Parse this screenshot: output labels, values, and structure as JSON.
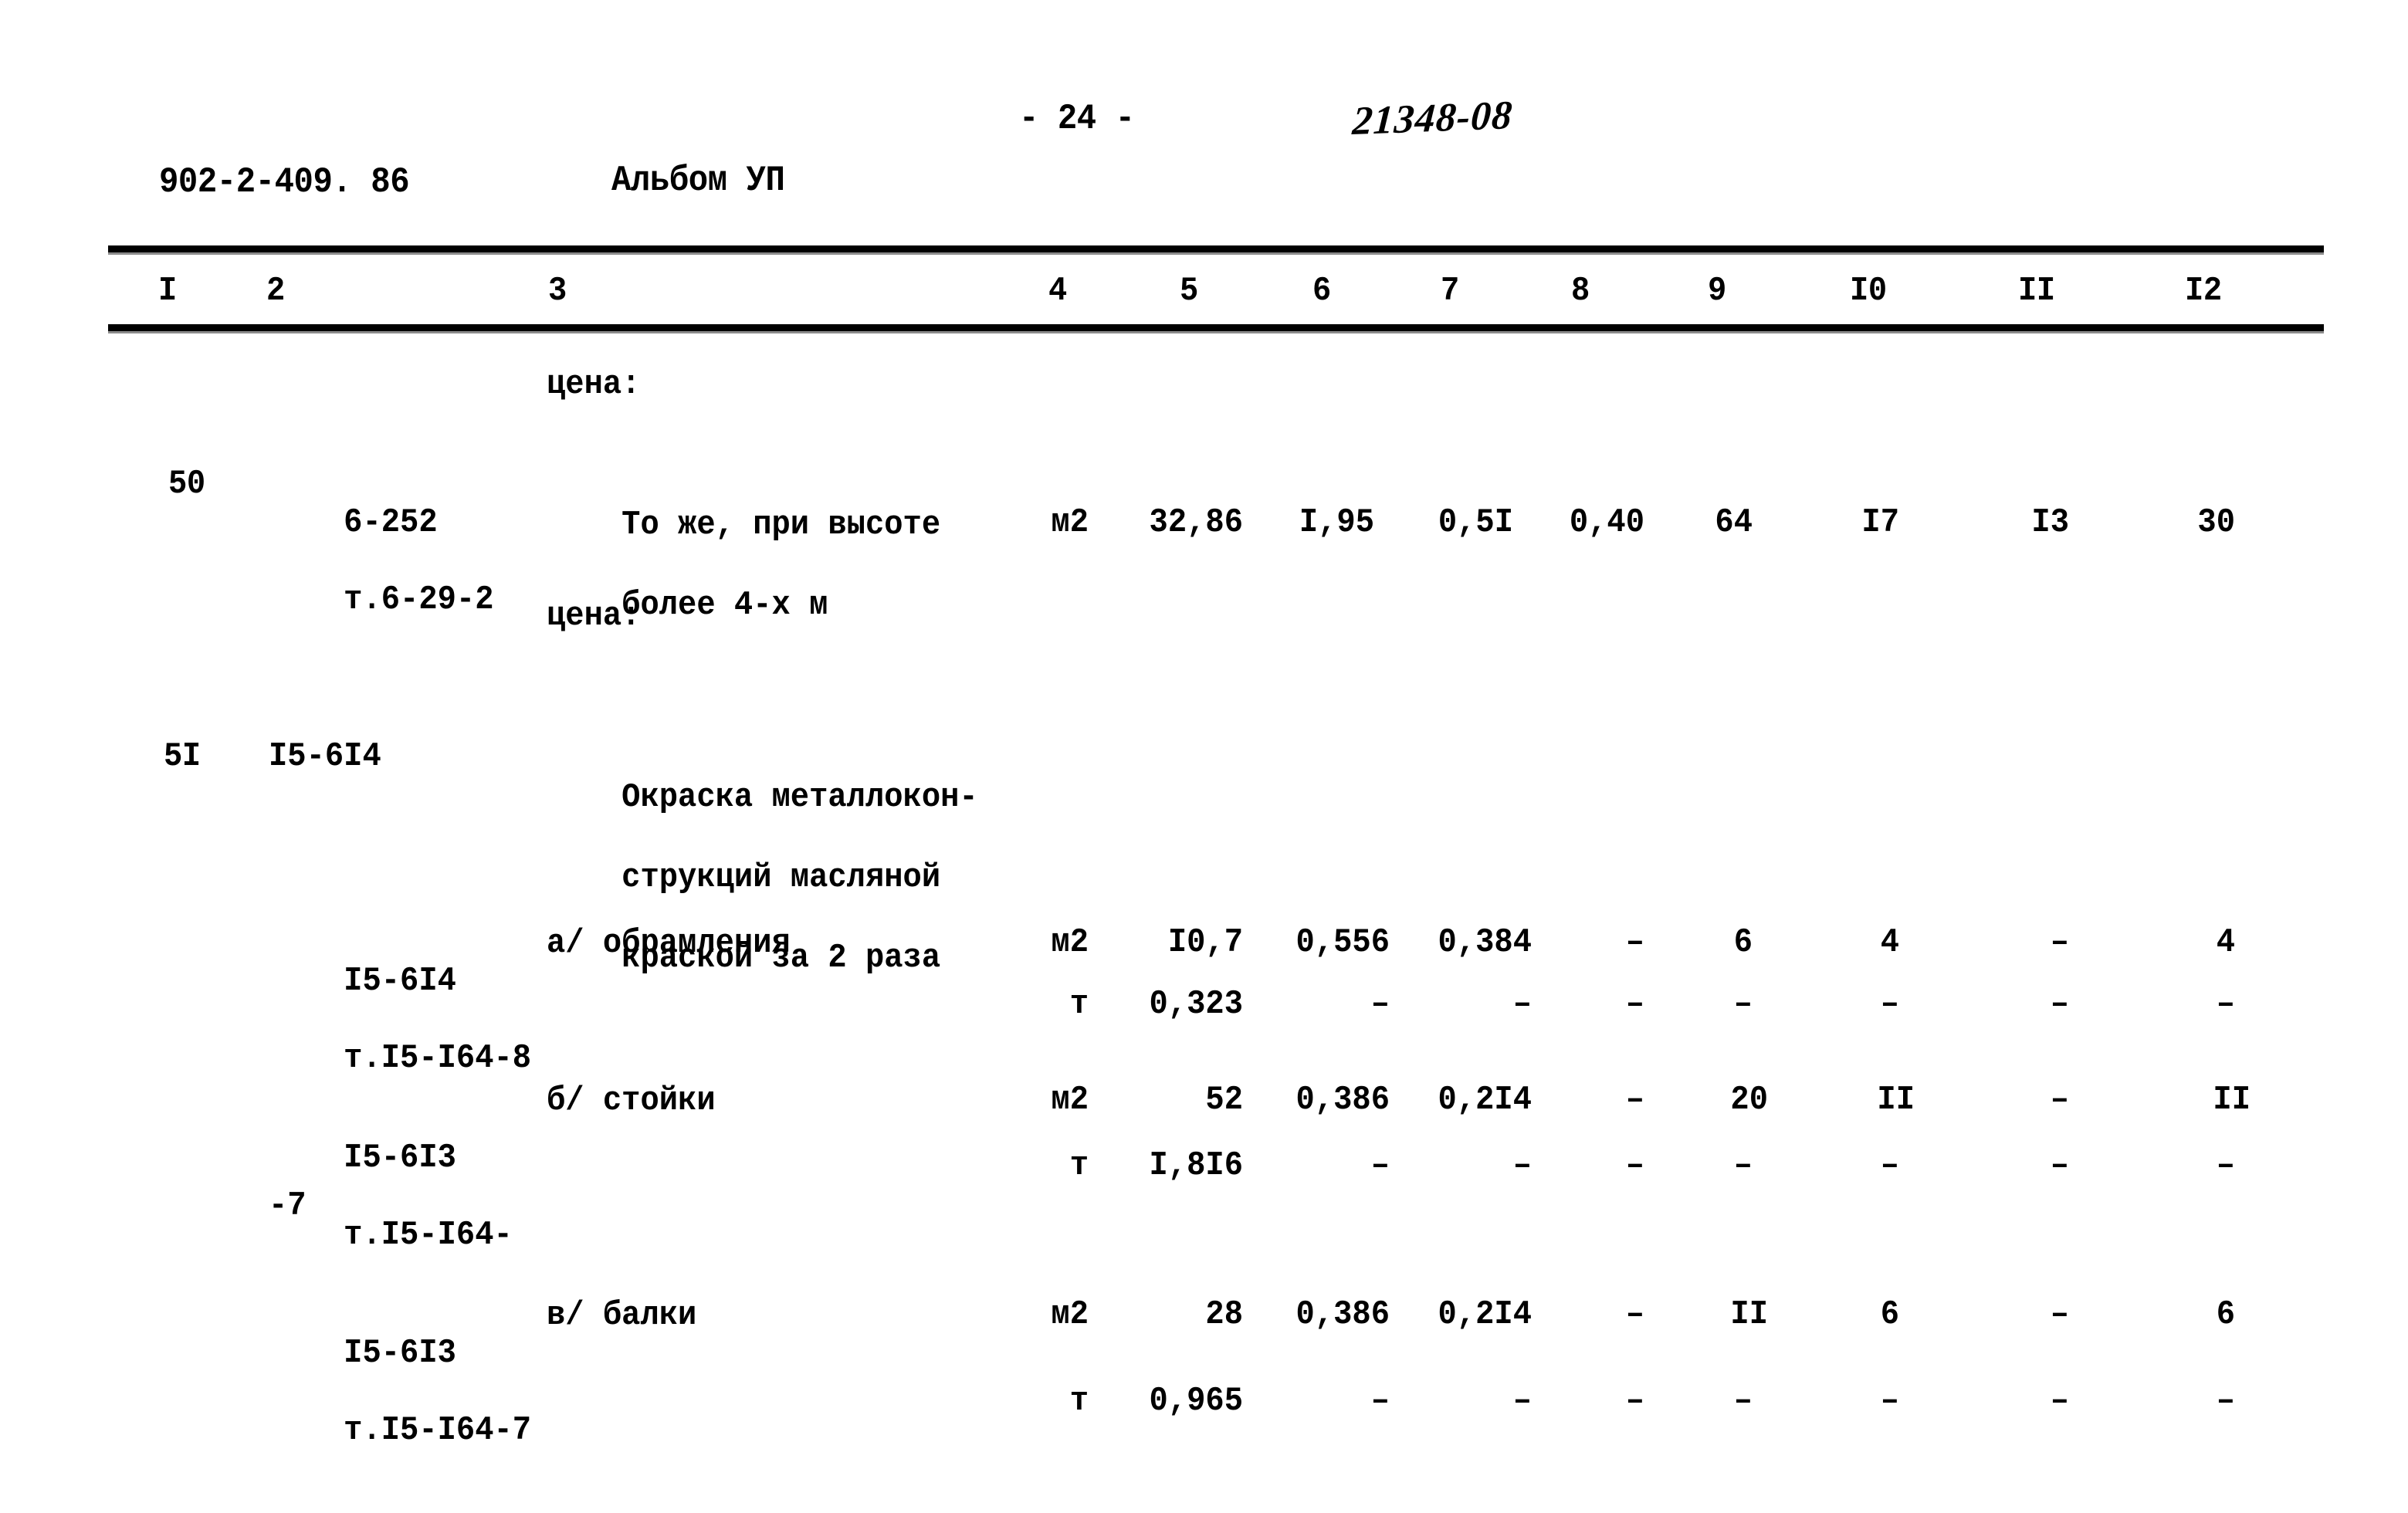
{
  "header": {
    "doc_code": "902-2-409. 86",
    "album": "Альбом УП",
    "page_marker": "- 24 -",
    "stamp": "21348-08"
  },
  "table": {
    "column_headers": [
      "I",
      "2",
      "3",
      "4",
      "5",
      "6",
      "7",
      "8",
      "9",
      "I0",
      "II",
      "I2"
    ],
    "price_label_1": "цена:",
    "price_label_2": "цена:",
    "rows": [
      {
        "num": "50",
        "code_line1": "6-252",
        "code_line2": "т.6-29-2",
        "desc_line1": "То же, при высоте",
        "desc_line2": "более 4-х м",
        "unit": "м2",
        "c5": "32,86",
        "c6": "I,95",
        "c7": "0,5I",
        "c8": "0,40",
        "c9": "64",
        "c10": "I7",
        "c11": "I3",
        "c12": "30"
      },
      {
        "num": "5I",
        "code_line1": "I5-6I4",
        "desc_line1": "Окраска металлокон-",
        "desc_line2": "струкций масляной",
        "desc_line3": "краской за 2 раза"
      }
    ],
    "subrows": [
      {
        "code_line1": "I5-6I4",
        "code_line2": "т.I5-I64-8",
        "desc": "а/ обрамления",
        "unit_a": "м2",
        "unit_b": "т",
        "a": {
          "c5": "I0,7",
          "c6": "0,556",
          "c7": "0,384",
          "c8": "–",
          "c9": "6",
          "c10": "4",
          "c11": "–",
          "c12": "4"
        },
        "b": {
          "c5": "0,323",
          "c6": "–",
          "c7": "–",
          "c8": "–",
          "c9": "–",
          "c10": "–",
          "c11": "–",
          "c12": "–"
        }
      },
      {
        "code_line1": "I5-6I3",
        "code_line2": "т.I5-I64-",
        "code_frag": "-7",
        "desc": "б/ стойки",
        "unit_a": "м2",
        "unit_b": "т",
        "a": {
          "c5": "52",
          "c6": "0,386",
          "c7": "0,2I4",
          "c8": "–",
          "c9": "20",
          "c10": "II",
          "c11": "–",
          "c12": "II"
        },
        "b": {
          "c5": "I,8I6",
          "c6": "–",
          "c7": "–",
          "c8": "–",
          "c9": "–",
          "c10": "–",
          "c11": "–",
          "c12": "–"
        }
      },
      {
        "code_line1": "I5-6I3",
        "code_line2": "т.I5-I64-7",
        "desc": "в/ балки",
        "unit_a": "м2",
        "unit_b": "т",
        "a": {
          "c5": "28",
          "c6": "0,386",
          "c7": "0,2I4",
          "c8": "–",
          "c9": "II",
          "c10": "6",
          "c11": "–",
          "c12": "6"
        },
        "b": {
          "c5": "0,965",
          "c6": "–",
          "c7": "–",
          "c8": "–",
          "c9": "–",
          "c10": "–",
          "c11": "–",
          "c12": "–"
        }
      }
    ]
  }
}
